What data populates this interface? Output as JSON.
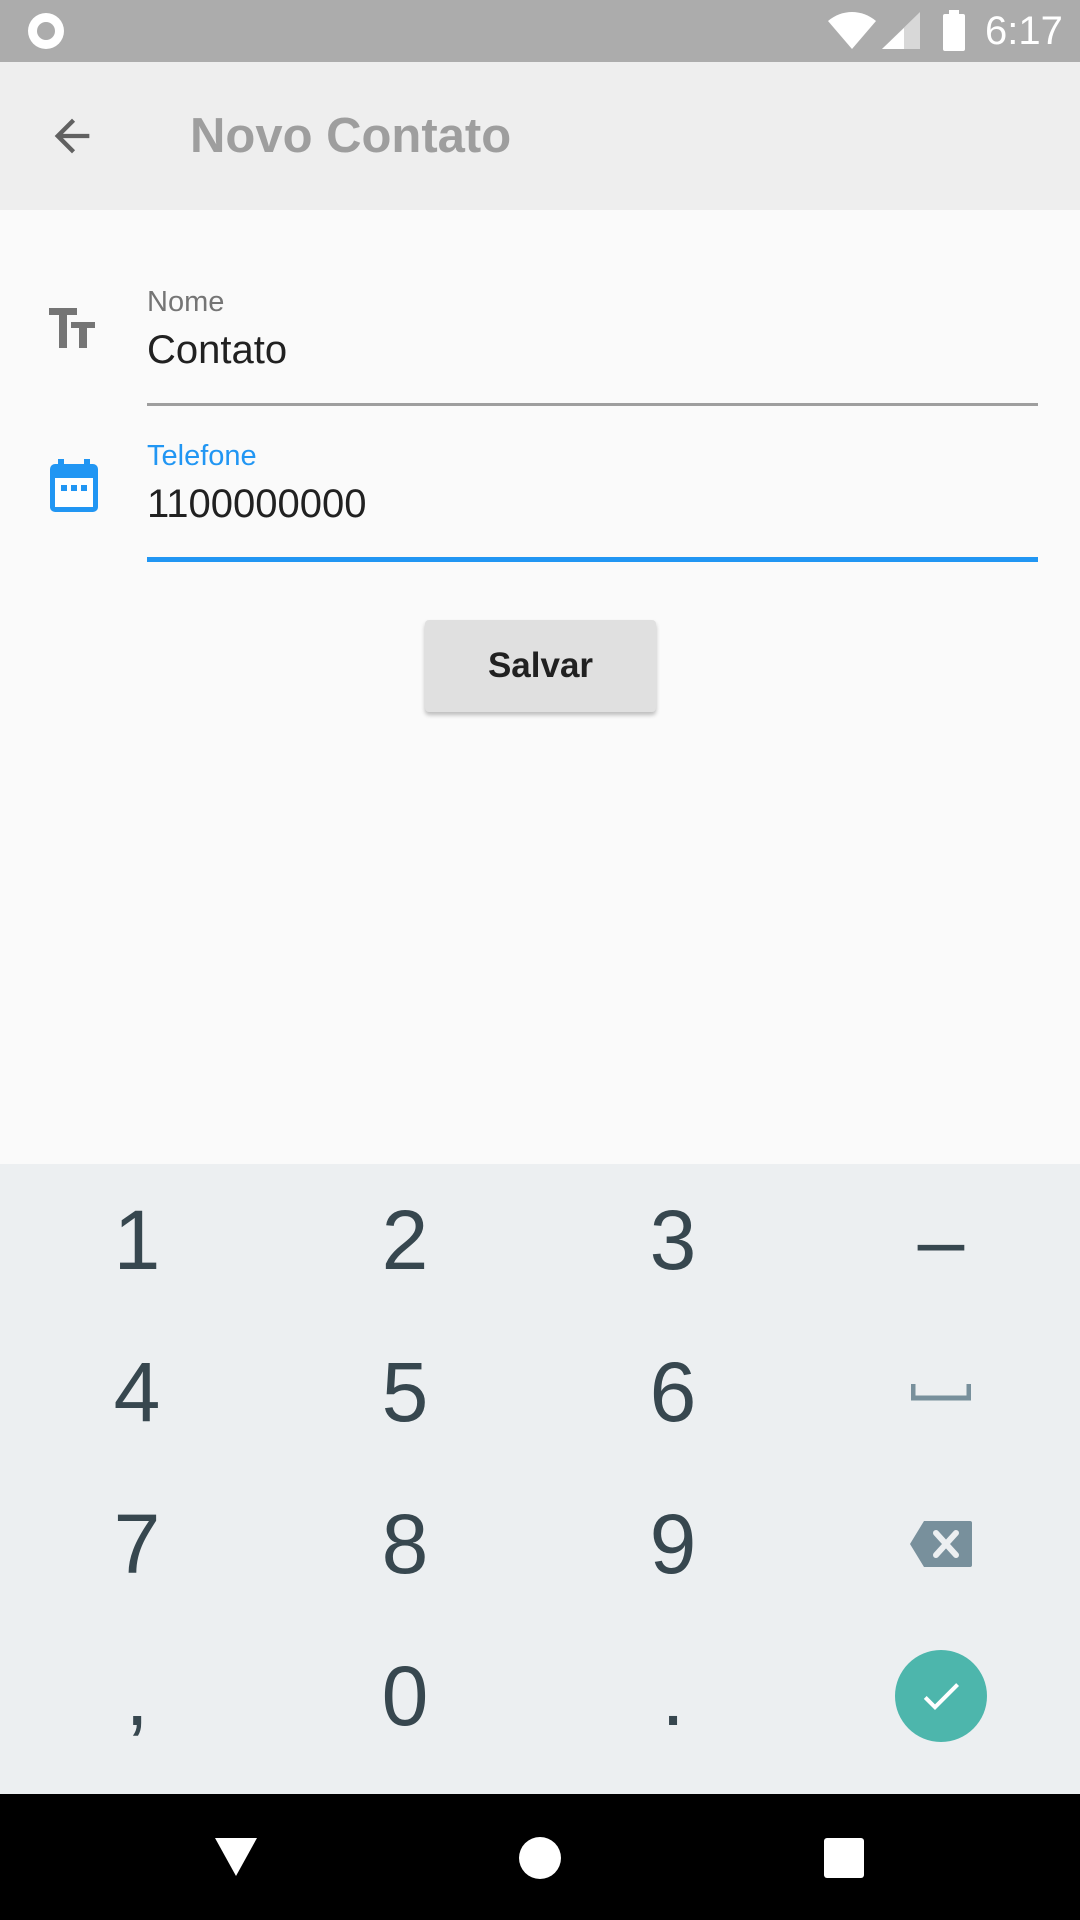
{
  "status_bar": {
    "time": "6:17",
    "icons": [
      "record-icon",
      "wifi-icon",
      "signal-icon",
      "battery-icon"
    ]
  },
  "app_bar": {
    "title": "Novo Contato",
    "back_icon": "arrow-back-icon"
  },
  "form": {
    "name_field": {
      "label": "Nome",
      "value": "Contato",
      "icon": "text-size-icon"
    },
    "phone_field": {
      "label": "Telefone",
      "value": "1100000000",
      "icon": "calendar-icon",
      "focused": true
    },
    "save_label": "Salvar"
  },
  "keyboard": {
    "rows": [
      [
        "1",
        "2",
        "3",
        "–"
      ],
      [
        "4",
        "5",
        "6",
        "space"
      ],
      [
        "7",
        "8",
        "9",
        "backspace"
      ],
      [
        ",",
        "0",
        ".",
        "done"
      ]
    ]
  },
  "navigation_bar": {
    "icons": [
      "back-triangle-icon",
      "home-circle-icon",
      "recents-square-icon"
    ]
  },
  "colors": {
    "accent": "#2196f3",
    "done_button": "#4db6ac",
    "status_bar": "#acacac",
    "app_bar": "#eeeeee",
    "keyboard_bg": "#eceff1",
    "key_text": "#37474f"
  }
}
